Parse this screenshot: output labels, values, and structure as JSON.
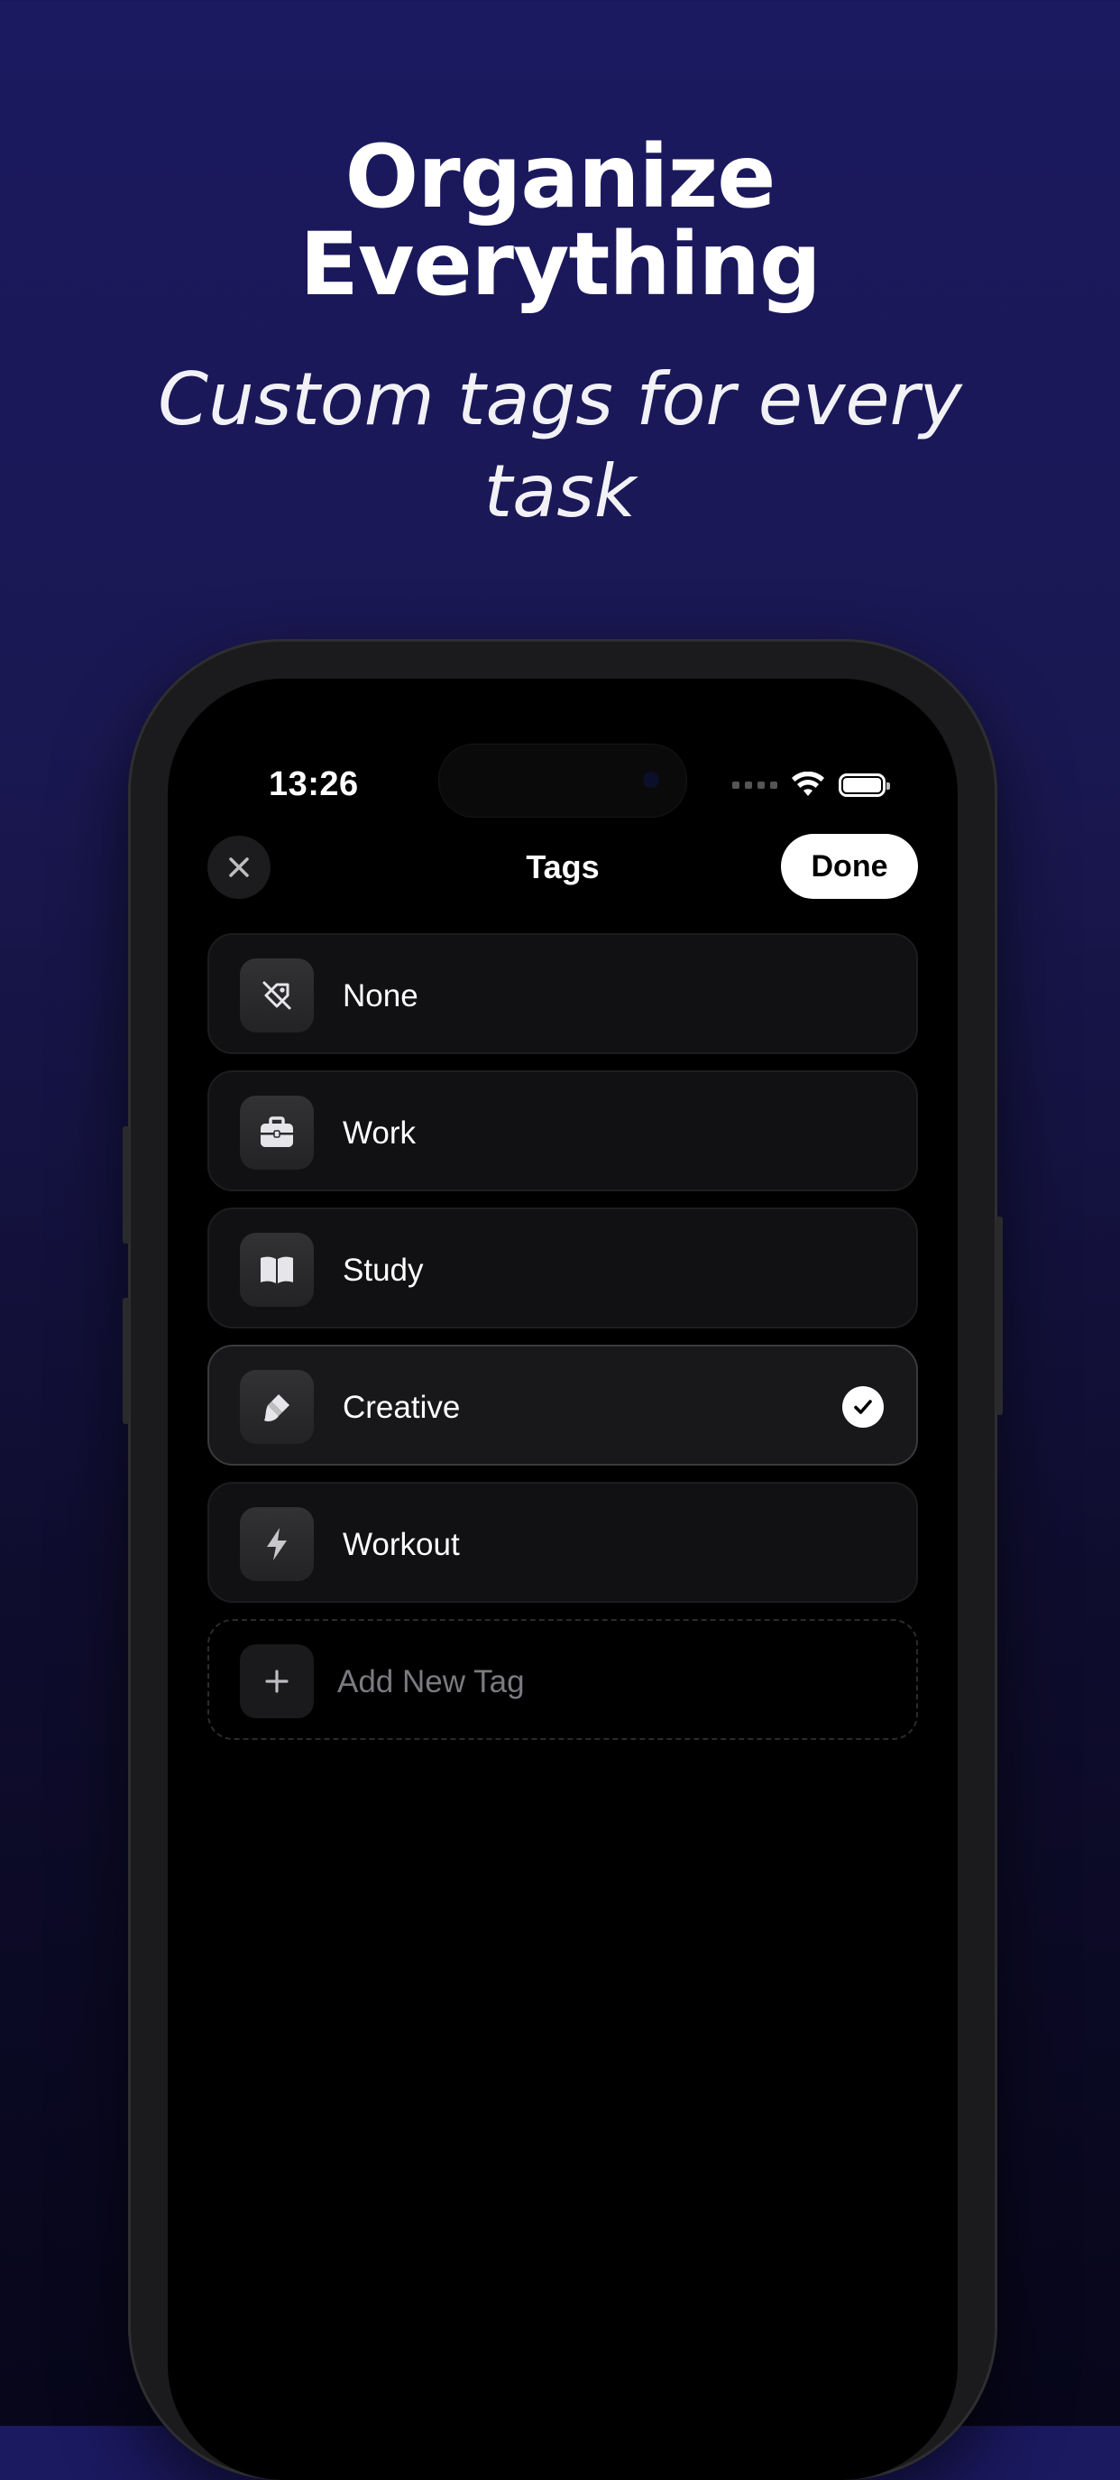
{
  "hero": {
    "title_line1": "Organize",
    "title_line2": "Everything",
    "subtitle_line1": "Custom tags for every",
    "subtitle_line2": "task"
  },
  "status_bar": {
    "time": "13:26",
    "icons": [
      "signal-icon",
      "wifi-icon",
      "battery-icon"
    ]
  },
  "nav": {
    "close_icon": "close-icon",
    "title": "Tags",
    "done_label": "Done"
  },
  "tags": [
    {
      "label": "None",
      "icon": "tag-slash-icon",
      "selected": false
    },
    {
      "label": "Work",
      "icon": "briefcase-icon",
      "selected": false
    },
    {
      "label": "Study",
      "icon": "book-icon",
      "selected": false
    },
    {
      "label": "Creative",
      "icon": "paintbrush-icon",
      "selected": true
    },
    {
      "label": "Workout",
      "icon": "bolt-icon",
      "selected": false
    }
  ],
  "add_tag": {
    "label": "Add New Tag",
    "icon": "plus-icon"
  },
  "colors": {
    "background_top": "#1b1960",
    "background_bottom": "#07061a",
    "screen": "#000000",
    "row": "#111113",
    "done_button": "#ffffff"
  }
}
